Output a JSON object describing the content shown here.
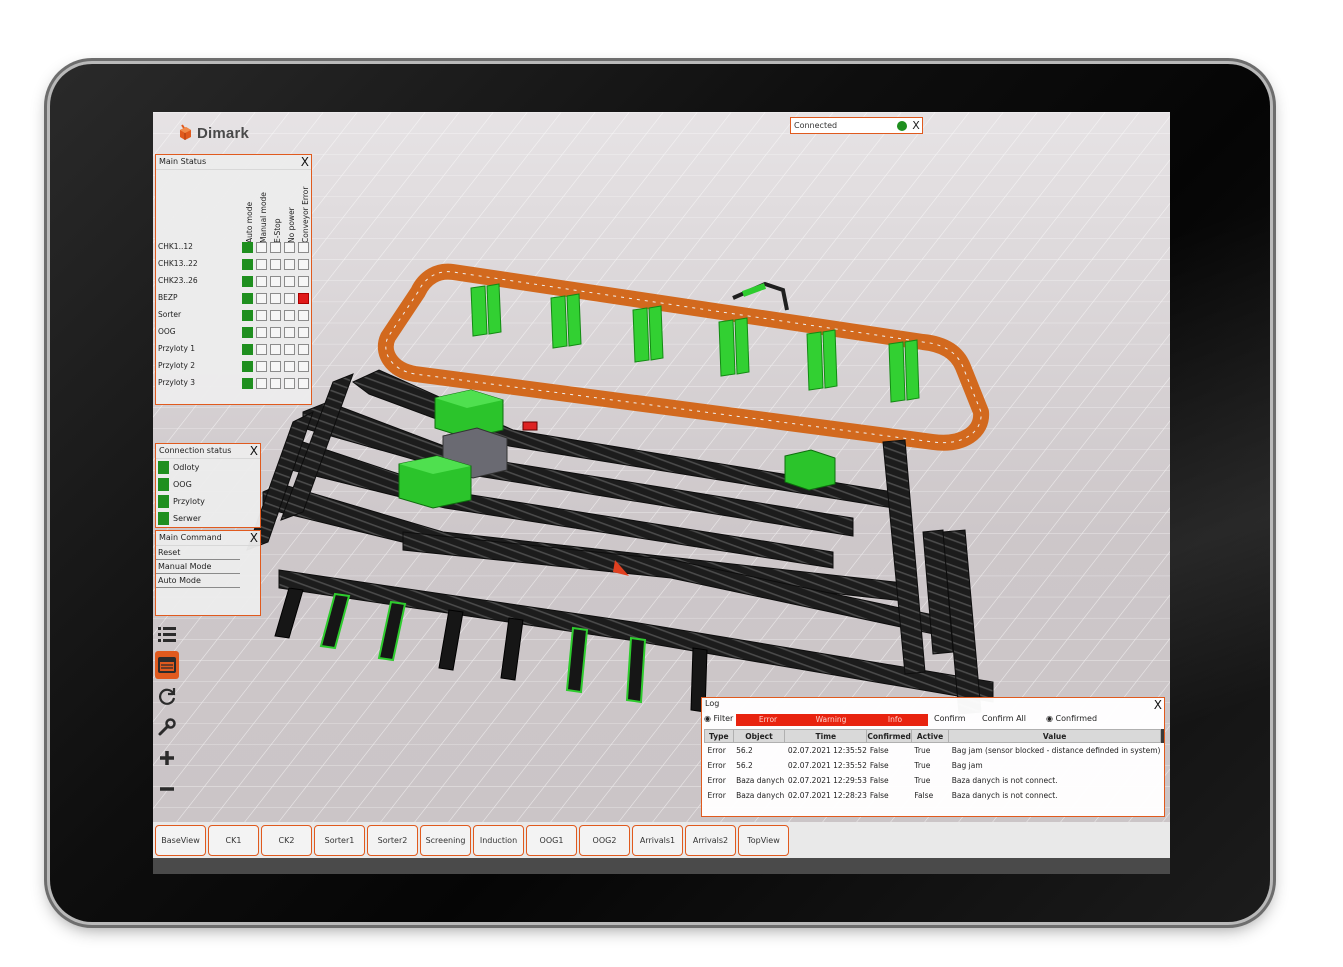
{
  "app": {
    "logo_text": "Dimark",
    "brand_color": "#e05a1e"
  },
  "connection": {
    "label": "Connected",
    "state_color": "#1f8f1f",
    "close_label": "X"
  },
  "main_status": {
    "title": "Main Status",
    "close_label": "X",
    "columns": [
      "Auto mode",
      "Manual mode",
      "E-Stop",
      "No power",
      "Conveyor Error"
    ],
    "rows": [
      {
        "name": "CHK1..12",
        "states": [
          1,
          0,
          0,
          0,
          0
        ]
      },
      {
        "name": "CHK13..22",
        "states": [
          1,
          0,
          0,
          0,
          0
        ]
      },
      {
        "name": "CHK23..26",
        "states": [
          1,
          0,
          0,
          0,
          0
        ]
      },
      {
        "name": "BEZP",
        "states": [
          1,
          0,
          0,
          0,
          2
        ]
      },
      {
        "name": "Sorter",
        "states": [
          1,
          0,
          0,
          0,
          0
        ]
      },
      {
        "name": "OOG",
        "states": [
          1,
          0,
          0,
          0,
          0
        ]
      },
      {
        "name": "Przyloty 1",
        "states": [
          1,
          0,
          0,
          0,
          0
        ]
      },
      {
        "name": "Przyloty 2",
        "states": [
          1,
          0,
          0,
          0,
          0
        ]
      },
      {
        "name": "Przyloty 3",
        "states": [
          1,
          0,
          0,
          0,
          0
        ]
      }
    ]
  },
  "connection_status": {
    "title": "Connection status",
    "close_label": "X",
    "items": [
      "Odloty",
      "OOG",
      "Przyloty",
      "Serwer"
    ]
  },
  "main_command": {
    "title": "Main Command",
    "close_label": "X",
    "items": [
      "Reset",
      "Manual Mode",
      "Auto Mode"
    ]
  },
  "toolbar": {
    "icons": [
      "list-icon",
      "panel-icon",
      "refresh-icon",
      "wrench-icon",
      "zoom-in-icon",
      "zoom-out-icon"
    ]
  },
  "log": {
    "title": "Log",
    "close_label": "X",
    "filter_label": "◉ Filter",
    "severity": [
      "Error",
      "Warning",
      "Info"
    ],
    "confirm_label": "Confirm",
    "confirm_all_label": "Confirm All",
    "confirmed_label": "◉ Confirmed",
    "columns": [
      "Type",
      "Object",
      "Time",
      "Confirmed",
      "Active",
      "Value"
    ],
    "rows": [
      {
        "type": "Error",
        "object": "56.2",
        "time": "02.07.2021 12:35:52",
        "confirmed": "False",
        "active": "True",
        "value": "Bag jam (sensor blocked - distance definded in system)"
      },
      {
        "type": "Error",
        "object": "56.2",
        "time": "02.07.2021 12:35:52",
        "confirmed": "False",
        "active": "True",
        "value": "Bag jam"
      },
      {
        "type": "Error",
        "object": "Baza danych",
        "time": "02.07.2021 12:29:53",
        "confirmed": "False",
        "active": "True",
        "value": "Baza danych is not connect."
      },
      {
        "type": "Error",
        "object": "Baza danych",
        "time": "02.07.2021 12:28:23",
        "confirmed": "False",
        "active": "False",
        "value": "Baza danych is not connect."
      }
    ]
  },
  "tabs": [
    "BaseView",
    "CK1",
    "CK2",
    "Sorter1",
    "Sorter2",
    "Screening",
    "Induction",
    "OOG1",
    "OOG2",
    "Arrivals1",
    "Arrivals2",
    "TopView"
  ]
}
